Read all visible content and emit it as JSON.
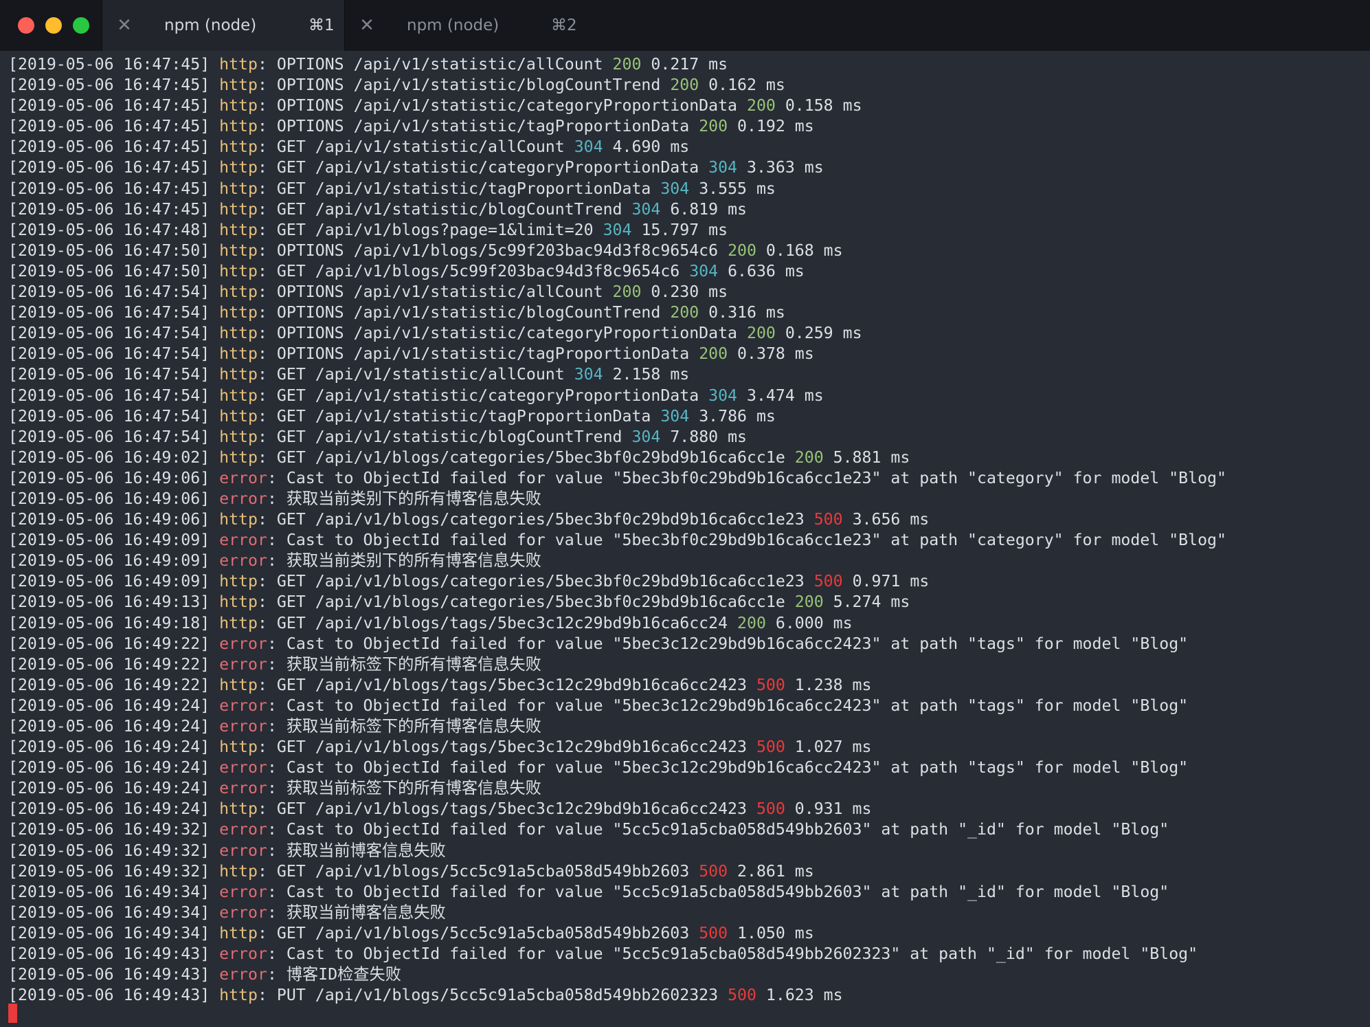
{
  "window": {
    "traffic_lights": {
      "close_color": "#fe5f57",
      "minimize_color": "#febc2e",
      "zoom_color": "#28c840"
    },
    "tabs": [
      {
        "close_glyph": "✕",
        "title": "npm (node)",
        "shortcut": "⌘1",
        "active": true
      },
      {
        "close_glyph": "✕",
        "title": "npm (node)",
        "shortcut": "⌘2",
        "active": false
      }
    ]
  },
  "colors": {
    "background": "#282c34",
    "text": "#dcdfe4",
    "http_level": "#e5c07b",
    "error_level": "#e06c75",
    "status_2xx": "#98c379",
    "status_3xx": "#56b6c2",
    "status_5xx": "#e83b3b",
    "cursor": "#e83b3b"
  },
  "terminal": {
    "lines": [
      {
        "ts": "[2019-05-06 16:47:45]",
        "level": "http",
        "method": "OPTIONS",
        "url": "/api/v1/statistic/allCount",
        "status": "200",
        "time": "0.217 ms"
      },
      {
        "ts": "[2019-05-06 16:47:45]",
        "level": "http",
        "method": "OPTIONS",
        "url": "/api/v1/statistic/blogCountTrend",
        "status": "200",
        "time": "0.162 ms"
      },
      {
        "ts": "[2019-05-06 16:47:45]",
        "level": "http",
        "method": "OPTIONS",
        "url": "/api/v1/statistic/categoryProportionData",
        "status": "200",
        "time": "0.158 ms"
      },
      {
        "ts": "[2019-05-06 16:47:45]",
        "level": "http",
        "method": "OPTIONS",
        "url": "/api/v1/statistic/tagProportionData",
        "status": "200",
        "time": "0.192 ms"
      },
      {
        "ts": "[2019-05-06 16:47:45]",
        "level": "http",
        "method": "GET",
        "url": "/api/v1/statistic/allCount",
        "status": "304",
        "time": "4.690 ms"
      },
      {
        "ts": "[2019-05-06 16:47:45]",
        "level": "http",
        "method": "GET",
        "url": "/api/v1/statistic/categoryProportionData",
        "status": "304",
        "time": "3.363 ms"
      },
      {
        "ts": "[2019-05-06 16:47:45]",
        "level": "http",
        "method": "GET",
        "url": "/api/v1/statistic/tagProportionData",
        "status": "304",
        "time": "3.555 ms"
      },
      {
        "ts": "[2019-05-06 16:47:45]",
        "level": "http",
        "method": "GET",
        "url": "/api/v1/statistic/blogCountTrend",
        "status": "304",
        "time": "6.819 ms"
      },
      {
        "ts": "[2019-05-06 16:47:48]",
        "level": "http",
        "method": "GET",
        "url": "/api/v1/blogs?page=1&limit=20",
        "status": "304",
        "time": "15.797 ms"
      },
      {
        "ts": "[2019-05-06 16:47:50]",
        "level": "http",
        "method": "OPTIONS",
        "url": "/api/v1/blogs/5c99f203bac94d3f8c9654c6",
        "status": "200",
        "time": "0.168 ms"
      },
      {
        "ts": "[2019-05-06 16:47:50]",
        "level": "http",
        "method": "GET",
        "url": "/api/v1/blogs/5c99f203bac94d3f8c9654c6",
        "status": "304",
        "time": "6.636 ms"
      },
      {
        "ts": "[2019-05-06 16:47:54]",
        "level": "http",
        "method": "OPTIONS",
        "url": "/api/v1/statistic/allCount",
        "status": "200",
        "time": "0.230 ms"
      },
      {
        "ts": "[2019-05-06 16:47:54]",
        "level": "http",
        "method": "OPTIONS",
        "url": "/api/v1/statistic/blogCountTrend",
        "status": "200",
        "time": "0.316 ms"
      },
      {
        "ts": "[2019-05-06 16:47:54]",
        "level": "http",
        "method": "OPTIONS",
        "url": "/api/v1/statistic/categoryProportionData",
        "status": "200",
        "time": "0.259 ms"
      },
      {
        "ts": "[2019-05-06 16:47:54]",
        "level": "http",
        "method": "OPTIONS",
        "url": "/api/v1/statistic/tagProportionData",
        "status": "200",
        "time": "0.378 ms"
      },
      {
        "ts": "[2019-05-06 16:47:54]",
        "level": "http",
        "method": "GET",
        "url": "/api/v1/statistic/allCount",
        "status": "304",
        "time": "2.158 ms"
      },
      {
        "ts": "[2019-05-06 16:47:54]",
        "level": "http",
        "method": "GET",
        "url": "/api/v1/statistic/categoryProportionData",
        "status": "304",
        "time": "3.474 ms"
      },
      {
        "ts": "[2019-05-06 16:47:54]",
        "level": "http",
        "method": "GET",
        "url": "/api/v1/statistic/tagProportionData",
        "status": "304",
        "time": "3.786 ms"
      },
      {
        "ts": "[2019-05-06 16:47:54]",
        "level": "http",
        "method": "GET",
        "url": "/api/v1/statistic/blogCountTrend",
        "status": "304",
        "time": "7.880 ms"
      },
      {
        "ts": "[2019-05-06 16:49:02]",
        "level": "http",
        "method": "GET",
        "url": "/api/v1/blogs/categories/5bec3bf0c29bd9b16ca6cc1e",
        "status": "200",
        "time": "5.881 ms"
      },
      {
        "ts": "[2019-05-06 16:49:06]",
        "level": "error",
        "message": "Cast to ObjectId failed for value \"5bec3bf0c29bd9b16ca6cc1e23\" at path \"category\" for model \"Blog\""
      },
      {
        "ts": "[2019-05-06 16:49:06]",
        "level": "error",
        "message": "获取当前类别下的所有博客信息失败"
      },
      {
        "ts": "[2019-05-06 16:49:06]",
        "level": "http",
        "method": "GET",
        "url": "/api/v1/blogs/categories/5bec3bf0c29bd9b16ca6cc1e23",
        "status": "500",
        "time": "3.656 ms"
      },
      {
        "ts": "[2019-05-06 16:49:09]",
        "level": "error",
        "message": "Cast to ObjectId failed for value \"5bec3bf0c29bd9b16ca6cc1e23\" at path \"category\" for model \"Blog\""
      },
      {
        "ts": "[2019-05-06 16:49:09]",
        "level": "error",
        "message": "获取当前类别下的所有博客信息失败"
      },
      {
        "ts": "[2019-05-06 16:49:09]",
        "level": "http",
        "method": "GET",
        "url": "/api/v1/blogs/categories/5bec3bf0c29bd9b16ca6cc1e23",
        "status": "500",
        "time": "0.971 ms"
      },
      {
        "ts": "[2019-05-06 16:49:13]",
        "level": "http",
        "method": "GET",
        "url": "/api/v1/blogs/categories/5bec3bf0c29bd9b16ca6cc1e",
        "status": "200",
        "time": "5.274 ms"
      },
      {
        "ts": "[2019-05-06 16:49:18]",
        "level": "http",
        "method": "GET",
        "url": "/api/v1/blogs/tags/5bec3c12c29bd9b16ca6cc24",
        "status": "200",
        "time": "6.000 ms"
      },
      {
        "ts": "[2019-05-06 16:49:22]",
        "level": "error",
        "message": "Cast to ObjectId failed for value \"5bec3c12c29bd9b16ca6cc2423\" at path \"tags\" for model \"Blog\""
      },
      {
        "ts": "[2019-05-06 16:49:22]",
        "level": "error",
        "message": "获取当前标签下的所有博客信息失败"
      },
      {
        "ts": "[2019-05-06 16:49:22]",
        "level": "http",
        "method": "GET",
        "url": "/api/v1/blogs/tags/5bec3c12c29bd9b16ca6cc2423",
        "status": "500",
        "time": "1.238 ms"
      },
      {
        "ts": "[2019-05-06 16:49:24]",
        "level": "error",
        "message": "Cast to ObjectId failed for value \"5bec3c12c29bd9b16ca6cc2423\" at path \"tags\" for model \"Blog\""
      },
      {
        "ts": "[2019-05-06 16:49:24]",
        "level": "error",
        "message": "获取当前标签下的所有博客信息失败"
      },
      {
        "ts": "[2019-05-06 16:49:24]",
        "level": "http",
        "method": "GET",
        "url": "/api/v1/blogs/tags/5bec3c12c29bd9b16ca6cc2423",
        "status": "500",
        "time": "1.027 ms"
      },
      {
        "ts": "[2019-05-06 16:49:24]",
        "level": "error",
        "message": "Cast to ObjectId failed for value \"5bec3c12c29bd9b16ca6cc2423\" at path \"tags\" for model \"Blog\""
      },
      {
        "ts": "[2019-05-06 16:49:24]",
        "level": "error",
        "message": "获取当前标签下的所有博客信息失败"
      },
      {
        "ts": "[2019-05-06 16:49:24]",
        "level": "http",
        "method": "GET",
        "url": "/api/v1/blogs/tags/5bec3c12c29bd9b16ca6cc2423",
        "status": "500",
        "time": "0.931 ms"
      },
      {
        "ts": "[2019-05-06 16:49:32]",
        "level": "error",
        "message": "Cast to ObjectId failed for value \"5cc5c91a5cba058d549bb2603\" at path \"_id\" for model \"Blog\""
      },
      {
        "ts": "[2019-05-06 16:49:32]",
        "level": "error",
        "message": "获取当前博客信息失败"
      },
      {
        "ts": "[2019-05-06 16:49:32]",
        "level": "http",
        "method": "GET",
        "url": "/api/v1/blogs/5cc5c91a5cba058d549bb2603",
        "status": "500",
        "time": "2.861 ms"
      },
      {
        "ts": "[2019-05-06 16:49:34]",
        "level": "error",
        "message": "Cast to ObjectId failed for value \"5cc5c91a5cba058d549bb2603\" at path \"_id\" for model \"Blog\""
      },
      {
        "ts": "[2019-05-06 16:49:34]",
        "level": "error",
        "message": "获取当前博客信息失败"
      },
      {
        "ts": "[2019-05-06 16:49:34]",
        "level": "http",
        "method": "GET",
        "url": "/api/v1/blogs/5cc5c91a5cba058d549bb2603",
        "status": "500",
        "time": "1.050 ms"
      },
      {
        "ts": "[2019-05-06 16:49:43]",
        "level": "error",
        "message": "Cast to ObjectId failed for value \"5cc5c91a5cba058d549bb2602323\" at path \"_id\" for model \"Blog\""
      },
      {
        "ts": "[2019-05-06 16:49:43]",
        "level": "error",
        "message": "博客ID检查失败"
      },
      {
        "ts": "[2019-05-06 16:49:43]",
        "level": "http",
        "method": "PUT",
        "url": "/api/v1/blogs/5cc5c91a5cba058d549bb2602323",
        "status": "500",
        "time": "1.623 ms"
      }
    ]
  }
}
